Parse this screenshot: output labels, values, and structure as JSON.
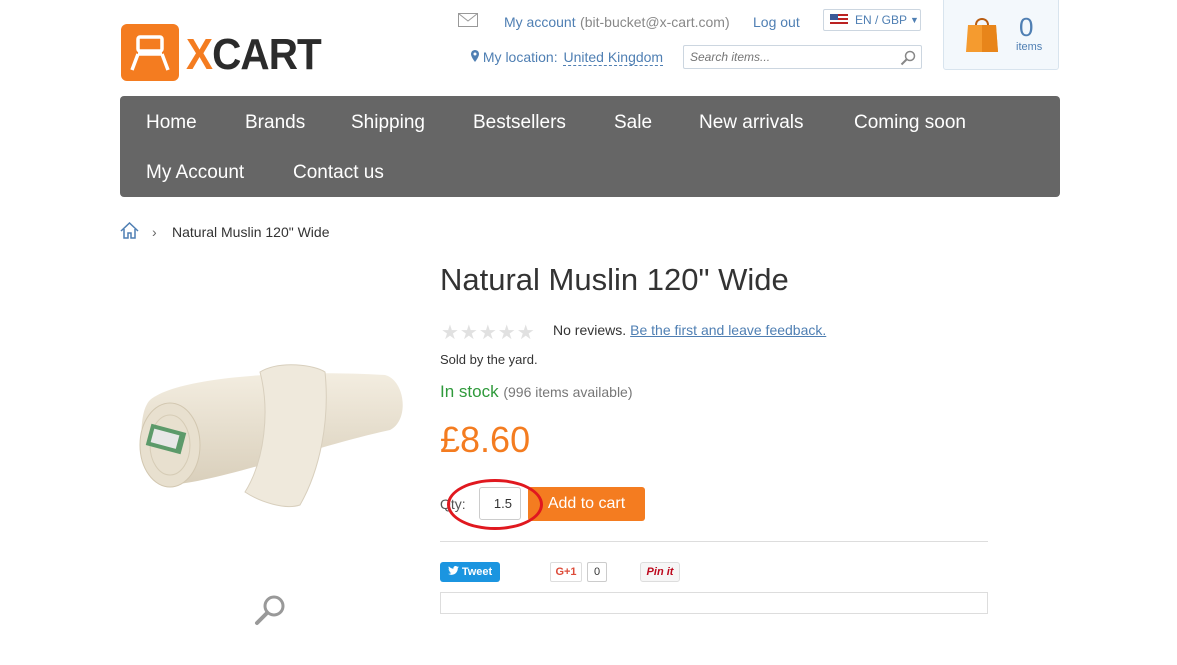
{
  "logo": {
    "text_x": "X",
    "text_rest": "CART"
  },
  "header": {
    "my_account": "My account",
    "account_email": "(bit-bucket@x-cart.com)",
    "logout": "Log out",
    "lang_currency": "EN / GBP",
    "location_label": "My location:",
    "location_value": "United Kingdom",
    "search_placeholder": "Search items...",
    "cart_count": "0",
    "cart_items_label": "items"
  },
  "nav": {
    "items": [
      {
        "label": "Home"
      },
      {
        "label": "Brands"
      },
      {
        "label": "Shipping"
      },
      {
        "label": "Bestsellers"
      },
      {
        "label": "Sale"
      },
      {
        "label": "New arrivals"
      },
      {
        "label": "Coming soon"
      },
      {
        "label": "My Account"
      },
      {
        "label": "Contact us"
      }
    ]
  },
  "breadcrumb": {
    "separator": "›",
    "current": "Natural Muslin 120\" Wide"
  },
  "product": {
    "title": "Natural Muslin 120\" Wide",
    "rating_stars": 0,
    "no_reviews": "No reviews.",
    "feedback_link": "Be the first and leave feedback.",
    "sold_by": "Sold by the yard.",
    "stock": "In stock",
    "available": "(996 items available)",
    "price": "£8.60",
    "qty_label": "Qty:",
    "qty_value": "1.5",
    "add_to_cart": "Add to cart"
  },
  "social": {
    "tweet": "Tweet",
    "gplus": "G+1",
    "gplus_count": "0",
    "pinit": "Pin it"
  },
  "colors": {
    "accent": "#f47c20",
    "nav_bg": "#666666",
    "link": "#4f7fb3",
    "in_stock": "#2f9a3b",
    "highlight": "#e0181f"
  }
}
